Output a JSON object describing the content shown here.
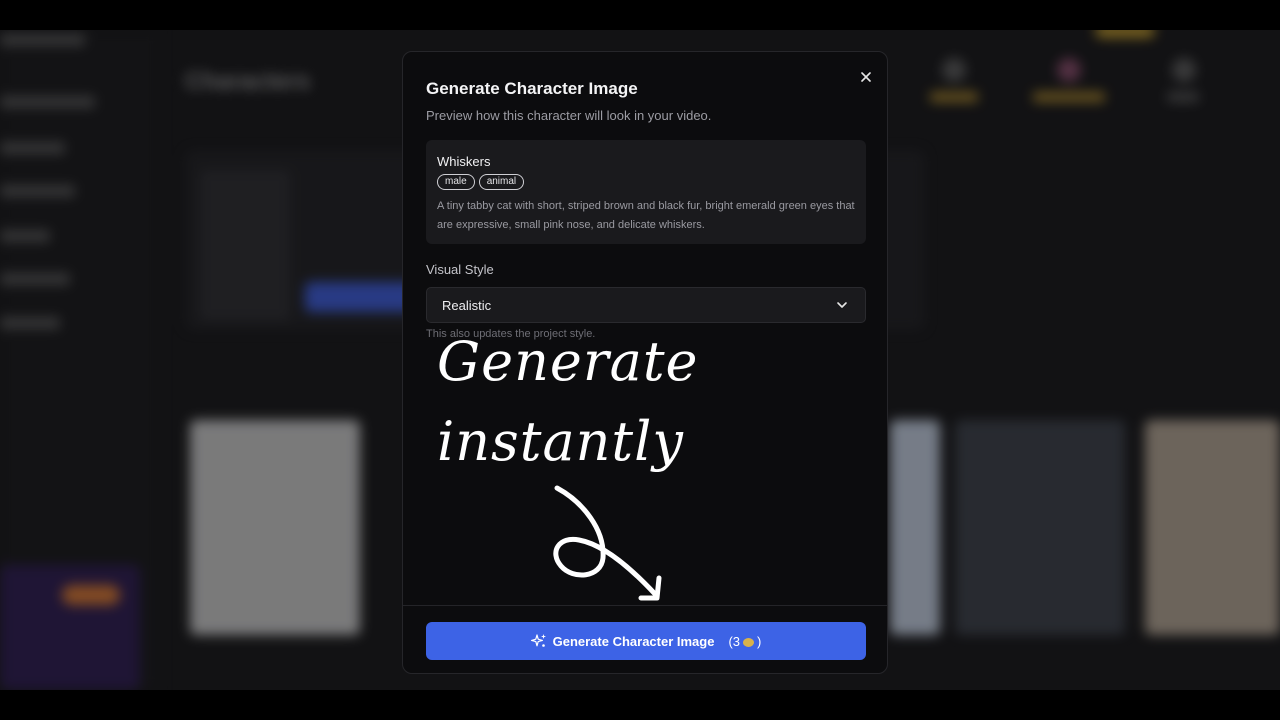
{
  "modal": {
    "title": "Generate Character Image",
    "subtitle": "Preview how this character will look in your video.",
    "character": {
      "name": "Whiskers",
      "tags": [
        "male",
        "animal"
      ],
      "description": "A tiny tabby cat with short, striped brown and black fur, bright emerald green eyes that are expressive, small pink nose, and delicate whiskers."
    },
    "visual_style": {
      "label": "Visual Style",
      "selected": "Realistic",
      "hint": "This also updates the project style."
    },
    "annotation": {
      "line1": "Generate",
      "line2": "instantly"
    },
    "generate_button": {
      "label": "Generate Character Image",
      "cost_open": "(3",
      "cost_close": ")"
    }
  },
  "background": {
    "page_title": "Characters"
  },
  "colors": {
    "accent": "#3d63e6",
    "modal_bg": "#0c0c0e",
    "card_bg": "#1a1a1d"
  }
}
